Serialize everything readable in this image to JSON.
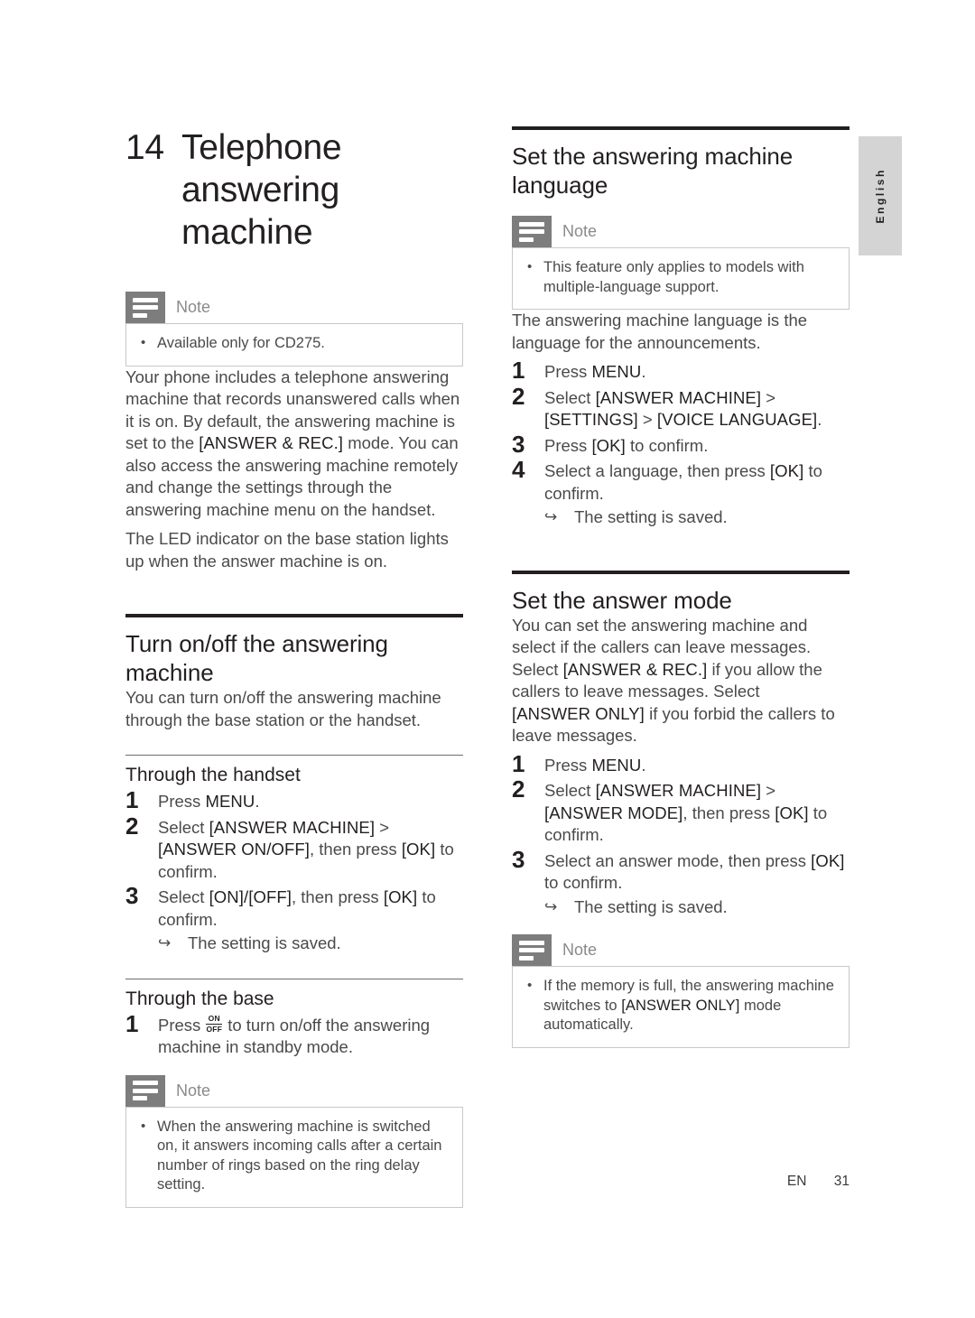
{
  "chapter": {
    "number": "14",
    "title": "Telephone answering machine"
  },
  "note_label": "Note",
  "left_column": {
    "intro_note": {
      "label": "Note",
      "items": [
        "Available only for CD275."
      ]
    },
    "paragraphs": [
      "Your phone includes a telephone answering machine that records unanswered calls when it is on. By default, the answering machine is set to the [ANSWER & REC.] mode. You can also access the answering machine remotely and change the settings through the answering machine menu on the handset.",
      "The LED indicator on the base station lights up when the answer machine is on."
    ],
    "section": {
      "heading": "Turn on/off the answering machine",
      "intro": "You can turn on/off the answering machine through the base station or the handset.",
      "sub_handset": {
        "heading": "Through the handset",
        "steps": [
          {
            "text": "Press MENU."
          },
          {
            "text": "Select [ANSWER MACHINE] > [ANSWER ON/OFF], then press [OK] to confirm."
          },
          {
            "text": "Select [ON]/[OFF], then press [OK] to confirm.",
            "result": "The setting is saved."
          }
        ]
      },
      "sub_base": {
        "heading": "Through the base",
        "step_prefix": "Press",
        "glyph_on": "ON",
        "glyph_off": "OFF",
        "step_suffix": "to turn on/off the answering machine in standby mode."
      },
      "note": {
        "label": "Note",
        "items": [
          "When the answering machine is switched on, it answers incoming calls after a certain number of rings based on the ring delay setting."
        ]
      }
    }
  },
  "right_column": {
    "section_language": {
      "heading": "Set the answering machine language",
      "note": {
        "label": "Note",
        "items": [
          "This feature only applies to models with multiple-language support."
        ]
      },
      "intro": "The answering machine language is the language for the announcements.",
      "steps": [
        {
          "text": "Press MENU."
        },
        {
          "text": "Select [ANSWER MACHINE] > [SETTINGS] > [VOICE LANGUAGE]."
        },
        {
          "text": "Press [OK] to confirm."
        },
        {
          "text": "Select a language, then press [OK] to confirm.",
          "result": "The setting is saved."
        }
      ]
    },
    "section_answer_mode": {
      "heading": "Set the answer mode",
      "intro": "You can set the answering machine and select if the callers can leave messages. Select [ANSWER & REC.] if you allow the callers to leave messages. Select [ANSWER ONLY] if you forbid the callers to leave messages.",
      "steps": [
        {
          "text": "Press MENU."
        },
        {
          "text": "Select [ANSWER MACHINE] > [ANSWER MODE], then press [OK] to confirm."
        },
        {
          "text": "Select an answer mode, then press [OK] to confirm.",
          "result": "The setting is saved."
        }
      ],
      "note": {
        "label": "Note",
        "items": [
          "If the memory is full, the answering machine switches to [ANSWER ONLY] mode automatically."
        ]
      }
    }
  },
  "side_tab": {
    "label": "English"
  },
  "footer": {
    "language_code": "EN",
    "page_number": "31"
  },
  "arrow_glyph": "↪",
  "colors": {
    "accent_dark": "#231f20",
    "note_icon": "#7d7d7d",
    "tab_gray": "#d4d4d4"
  }
}
